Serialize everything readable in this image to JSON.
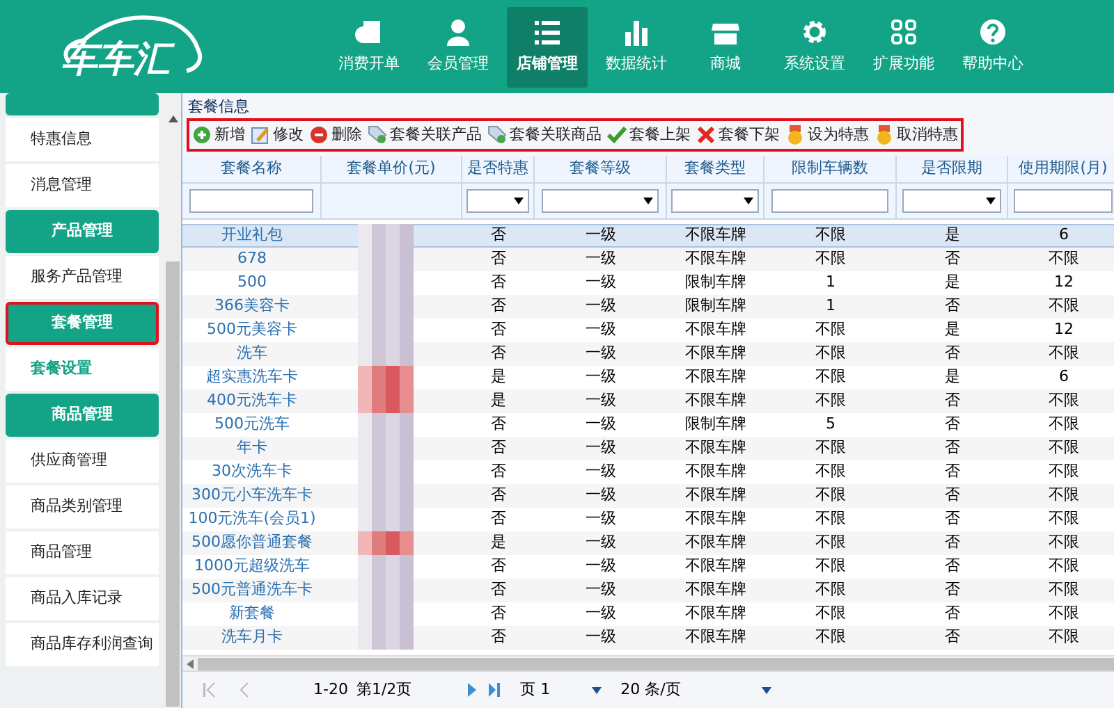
{
  "logo": {
    "text": "车车汇"
  },
  "nav": [
    {
      "label": "消费开单",
      "selected": false
    },
    {
      "label": "会员管理",
      "selected": false
    },
    {
      "label": "店铺管理",
      "selected": true
    },
    {
      "label": "数据统计",
      "selected": false
    },
    {
      "label": "商城",
      "selected": false
    },
    {
      "label": "系统设置",
      "selected": false
    },
    {
      "label": "扩展功能",
      "selected": false
    },
    {
      "label": "帮助中心",
      "selected": false
    }
  ],
  "sidebar": {
    "items": [
      {
        "kind": "header"
      },
      {
        "kind": "item",
        "label": "特惠信息",
        "selected": false
      },
      {
        "kind": "item",
        "label": "消息管理",
        "selected": false
      },
      {
        "kind": "header",
        "label": "产品管理",
        "highlighted": false
      },
      {
        "kind": "item",
        "label": "服务产品管理",
        "selected": false
      },
      {
        "kind": "header",
        "label": "套餐管理",
        "highlighted": true
      },
      {
        "kind": "item",
        "label": "套餐设置",
        "selected": true
      },
      {
        "kind": "header",
        "label": "商品管理",
        "highlighted": false
      },
      {
        "kind": "item",
        "label": "供应商管理",
        "selected": false
      },
      {
        "kind": "item",
        "label": "商品类别管理",
        "selected": false
      },
      {
        "kind": "item",
        "label": "商品管理",
        "selected": false
      },
      {
        "kind": "item",
        "label": "商品入库记录",
        "selected": false
      },
      {
        "kind": "item",
        "label": "商品库存利润查询",
        "selected": false
      }
    ]
  },
  "panel": {
    "title": "套餐信息"
  },
  "toolbar": [
    {
      "label": "新增"
    },
    {
      "label": "修改"
    },
    {
      "label": "删除"
    },
    {
      "label": "套餐关联产品"
    },
    {
      "label": "套餐关联商品"
    },
    {
      "label": "套餐上架"
    },
    {
      "label": "套餐下架"
    },
    {
      "label": "设为特惠"
    },
    {
      "label": "取消特惠"
    }
  ],
  "table": {
    "columns": [
      {
        "label": "套餐名称",
        "kind": "text"
      },
      {
        "label": "套餐单价(元)",
        "kind": "plain"
      },
      {
        "label": "是否特惠",
        "kind": "select"
      },
      {
        "label": "套餐等级",
        "kind": "select"
      },
      {
        "label": "套餐类型",
        "kind": "select"
      },
      {
        "label": "限制车辆数",
        "kind": "text"
      },
      {
        "label": "是否限期",
        "kind": "select"
      },
      {
        "label": "使用期限(月)",
        "kind": "text"
      }
    ],
    "rows": [
      {
        "name": "开业礼包",
        "special": "否",
        "level": "一级",
        "type": "不限车牌",
        "count": "不限",
        "limited": "是",
        "period": "6",
        "selected": true
      },
      {
        "name": "678",
        "special": "否",
        "level": "一级",
        "type": "不限车牌",
        "count": "不限",
        "limited": "否",
        "period": "不限",
        "selected": false
      },
      {
        "name": "500",
        "special": "否",
        "level": "一级",
        "type": "限制车牌",
        "count": "1",
        "limited": "是",
        "period": "12",
        "selected": false
      },
      {
        "name": "366美容卡",
        "special": "否",
        "level": "一级",
        "type": "限制车牌",
        "count": "1",
        "limited": "否",
        "period": "不限",
        "selected": false
      },
      {
        "name": "500元美容卡",
        "special": "否",
        "level": "一级",
        "type": "不限车牌",
        "count": "不限",
        "limited": "是",
        "period": "12",
        "selected": false
      },
      {
        "name": "洗车",
        "special": "否",
        "level": "一级",
        "type": "不限车牌",
        "count": "不限",
        "limited": "否",
        "period": "不限",
        "selected": false
      },
      {
        "name": "超实惠洗车卡",
        "special": "是",
        "level": "一级",
        "type": "不限车牌",
        "count": "不限",
        "limited": "是",
        "period": "6",
        "selected": false
      },
      {
        "name": "400元洗车卡",
        "special": "是",
        "level": "一级",
        "type": "不限车牌",
        "count": "不限",
        "limited": "否",
        "period": "不限",
        "selected": false
      },
      {
        "name": "500元洗车",
        "special": "否",
        "level": "一级",
        "type": "限制车牌",
        "count": "5",
        "limited": "否",
        "period": "不限",
        "selected": false
      },
      {
        "name": "年卡",
        "special": "否",
        "level": "一级",
        "type": "不限车牌",
        "count": "不限",
        "limited": "否",
        "period": "不限",
        "selected": false
      },
      {
        "name": "30次洗车卡",
        "special": "否",
        "level": "一级",
        "type": "不限车牌",
        "count": "不限",
        "limited": "否",
        "period": "不限",
        "selected": false
      },
      {
        "name": "300元小车洗车卡",
        "special": "否",
        "level": "一级",
        "type": "不限车牌",
        "count": "不限",
        "limited": "否",
        "period": "不限",
        "selected": false
      },
      {
        "name": "100元洗车(会员1)",
        "special": "否",
        "level": "一级",
        "type": "不限车牌",
        "count": "不限",
        "limited": "否",
        "period": "不限",
        "selected": false
      },
      {
        "name": "500愿你普通套餐",
        "special": "是",
        "level": "一级",
        "type": "不限车牌",
        "count": "不限",
        "limited": "否",
        "period": "不限",
        "selected": false
      },
      {
        "name": "1000元超级洗车",
        "special": "否",
        "level": "一级",
        "type": "不限车牌",
        "count": "不限",
        "limited": "否",
        "period": "不限",
        "selected": false
      },
      {
        "name": "500元普通洗车卡",
        "special": "否",
        "level": "一级",
        "type": "不限车牌",
        "count": "不限",
        "limited": "否",
        "period": "不限",
        "selected": false
      },
      {
        "name": "新套餐",
        "special": "否",
        "level": "一级",
        "type": "不限车牌",
        "count": "不限",
        "limited": "否",
        "period": "不限",
        "selected": false
      },
      {
        "name": "洗车月卡",
        "special": "否",
        "level": "一级",
        "type": "不限车牌",
        "count": "不限",
        "limited": "否",
        "period": "不限",
        "selected": false
      }
    ]
  },
  "pager": {
    "range": "1-20",
    "page_info": "第1/2页",
    "page_select": "页 1",
    "size_select": "20 条/页"
  }
}
